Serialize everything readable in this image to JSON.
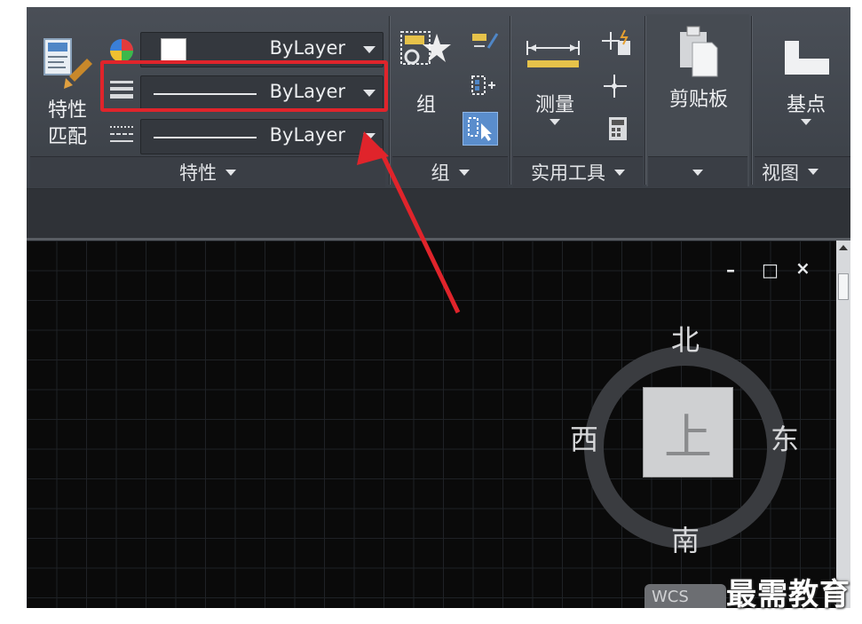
{
  "ribbon": {
    "properties_panel": {
      "match_button_label_line1": "特性",
      "match_button_label_line2": "匹配",
      "color_dropdown": {
        "value": "ByLayer"
      },
      "lineweight_dropdown": {
        "value": "ByLayer"
      },
      "linetype_dropdown": {
        "value": "ByLayer"
      },
      "footer": "特性"
    },
    "group_panel": {
      "button_label": "组",
      "footer": "组"
    },
    "utilities_panel": {
      "measure_label": "测量",
      "footer": "实用工具"
    },
    "clipboard_panel": {
      "paste_label": "剪贴板"
    },
    "view_panel": {
      "basepoint_label": "基点",
      "footer": "视图"
    }
  },
  "viewport_controls": {
    "minimize": "–",
    "restore": "□",
    "close": "×"
  },
  "viewcube": {
    "top": "上",
    "north": "北",
    "south": "南",
    "east": "东",
    "west": "西",
    "wcs_label": "WCS"
  },
  "watermark": "最需教育",
  "colors": {
    "highlight": "#e0242b",
    "ribbon": "#3f444b",
    "canvas": "#0a0a0a"
  }
}
